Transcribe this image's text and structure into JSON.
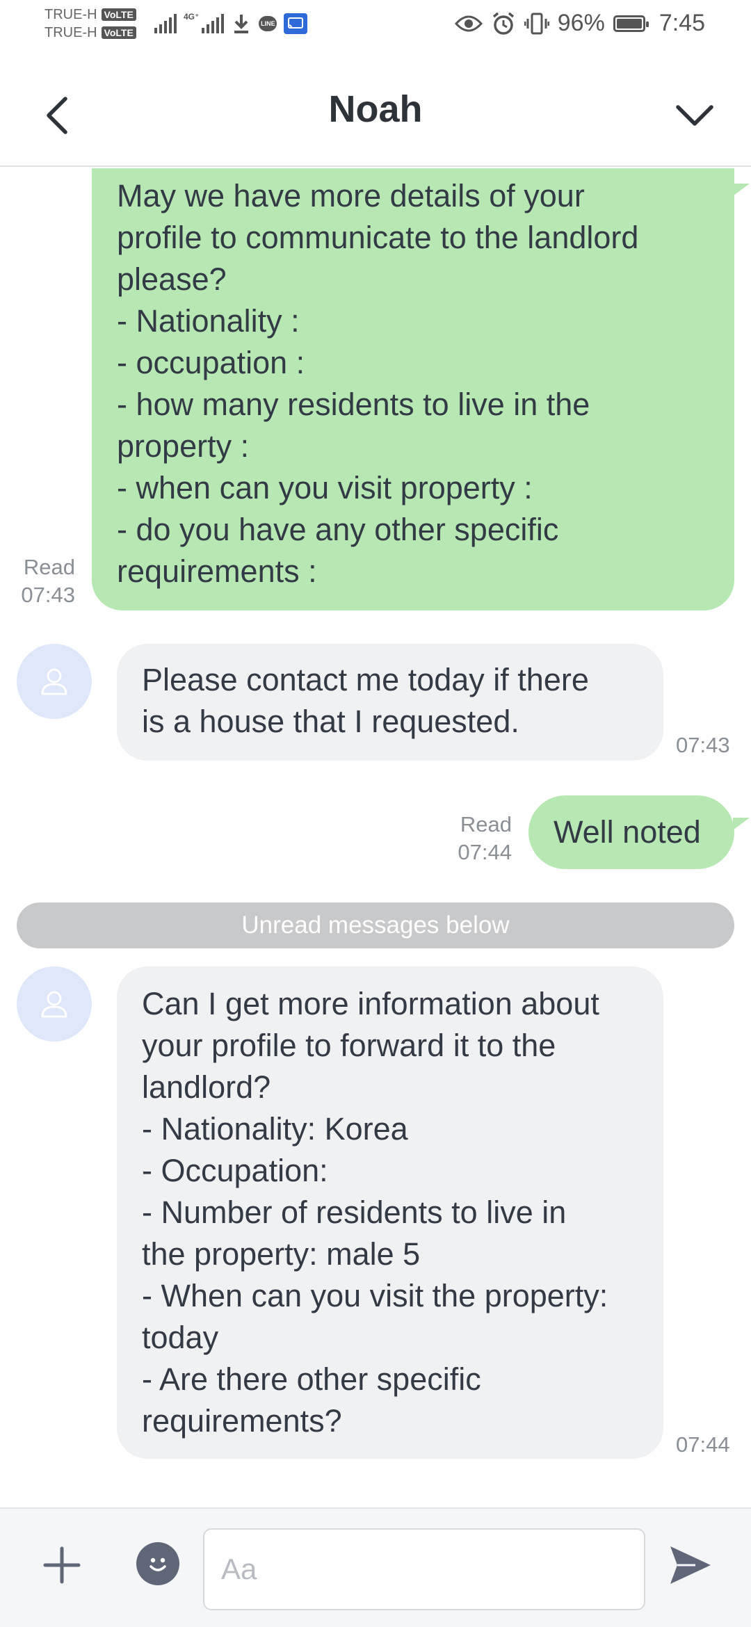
{
  "status_bar": {
    "carrier1": "TRUE-H",
    "carrier2": "TRUE-H",
    "volte_label": "VoLTE",
    "network_label": "4G⁺",
    "line_label": "LINE",
    "battery_percent": "96%",
    "time": "7:45"
  },
  "header": {
    "title": "Noah",
    "back_icon": "chevron-left-icon",
    "menu_icon": "chevron-down-icon"
  },
  "messages": {
    "m1": {
      "direction": "outgoing",
      "text": "May we have more details of your\nprofile to communicate to the landlord\nplease?\n- Nationality :\n- occupation :\n- how many residents to live in the\nproperty :\n- when can you visit property :\n- do you have any other specific\nrequirements :",
      "read_label": "Read",
      "time": "07:43"
    },
    "m2": {
      "direction": "incoming",
      "text": "Please contact me today if there\nis a house that I requested.",
      "time": "07:43"
    },
    "m3": {
      "direction": "outgoing",
      "text": "Well noted",
      "read_label": "Read",
      "time": "07:44"
    },
    "m4": {
      "direction": "incoming",
      "text": "Can I get more information about\nyour profile to forward it to the\nlandlord?\n- Nationality: Korea\n- Occupation:\n- Number of residents to live in\nthe property: male 5\n- When can you visit the property:\ntoday\n- Are there other specific\nrequirements?",
      "time": "07:44"
    }
  },
  "unread_divider": "Unread messages below",
  "input_bar": {
    "placeholder": "Aa",
    "value": ""
  },
  "colors": {
    "outgoing_bubble": "#b7e8b4",
    "incoming_bubble": "#f0f1f3",
    "avatar_bg": "#dfe7fb",
    "divider_bg": "#c8c9cb"
  }
}
